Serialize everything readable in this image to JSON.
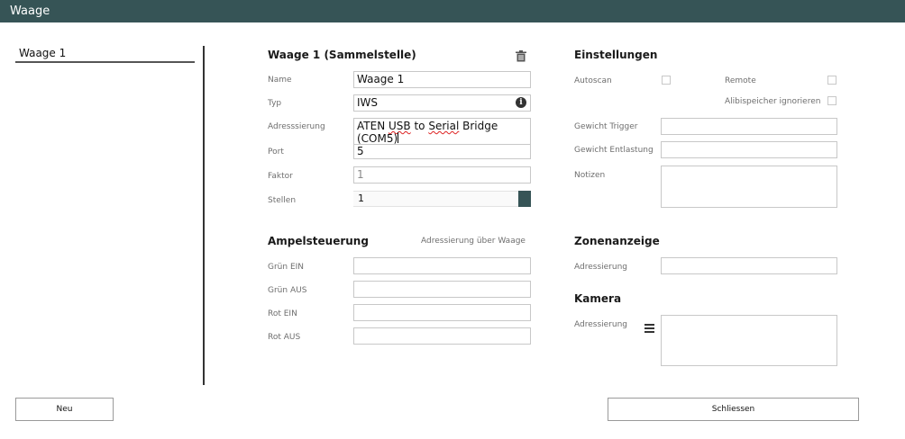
{
  "window": {
    "title": "Waage"
  },
  "sidebar": {
    "items": [
      {
        "label": "Waage 1"
      }
    ]
  },
  "scale": {
    "heading": "Waage 1 (Sammelstelle)",
    "name": {
      "label": "Name",
      "value": "Waage 1"
    },
    "typ": {
      "label": "Typ",
      "value": "IWS"
    },
    "adressierung": {
      "label": "Adresssierung",
      "value_part1": "ATEN",
      "value_part2": "USB",
      "value_part3": "to",
      "value_part4": "Serial",
      "value_part5": "Bridge",
      "value_line2": "(COM5)"
    },
    "port": {
      "label": "Port",
      "value": "5"
    },
    "faktor": {
      "label": "Faktor",
      "value": "1"
    },
    "stellen": {
      "label": "Stellen",
      "value": "1"
    }
  },
  "ampel": {
    "heading": "Ampelsteuerung",
    "note": "Adressierung über Waage",
    "fields": [
      {
        "label": "Grün EIN",
        "value": ""
      },
      {
        "label": "Grün AUS",
        "value": ""
      },
      {
        "label": "Rot EIN",
        "value": ""
      },
      {
        "label": "Rot AUS",
        "value": ""
      }
    ]
  },
  "einstellungen": {
    "heading": "Einstellungen",
    "autoscan": {
      "label": "Autoscan",
      "checked": false
    },
    "remote": {
      "label": "Remote",
      "checked": false
    },
    "alibi": {
      "label": "Alibispeicher ignorieren",
      "checked": false
    },
    "gewicht_trigger": {
      "label": "Gewicht Trigger",
      "value": ""
    },
    "gewicht_entlastung": {
      "label": "Gewicht Entlastung",
      "value": ""
    },
    "notizen": {
      "label": "Notizen",
      "value": ""
    }
  },
  "zonen": {
    "heading": "Zonenanzeige",
    "adressierung_label": "Adressierung",
    "value": ""
  },
  "kamera": {
    "heading": "Kamera",
    "adressierung_label": "Adressierung",
    "value": ""
  },
  "buttons": {
    "neu": "Neu",
    "schliessen": "Schliessen"
  },
  "icons": {
    "delete": "trash-icon",
    "info": "info-icon",
    "menu": "menu-icon"
  },
  "colors": {
    "accent": "#365456"
  }
}
